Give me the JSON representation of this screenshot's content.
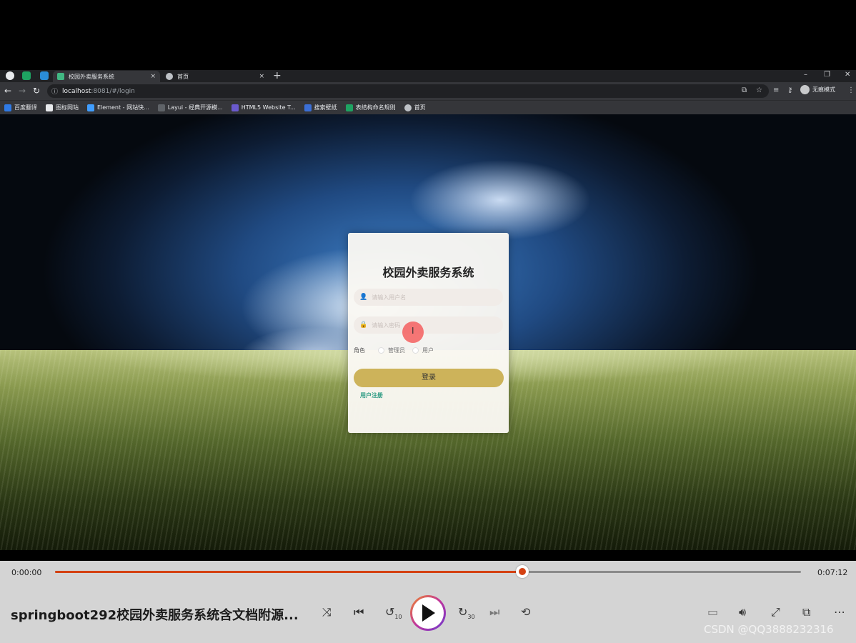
{
  "browser": {
    "tabs": [
      {
        "title": "校园外卖服务系统",
        "close": "×"
      },
      {
        "title": "首页",
        "close": "×"
      }
    ],
    "new_tab": "+",
    "window_controls": {
      "minimize": "–",
      "restore": "❐",
      "close": "✕"
    },
    "url_host": "localhost",
    "url_path": ":8081/#/login",
    "profile_label": "无痕模式",
    "bookmarks": [
      "百度翻译",
      "图标网站",
      "Element - 网站快...",
      "Layui - 经典开源模...",
      "HTML5 Website T...",
      "搜索壁纸",
      "表结构命名规则",
      "首页"
    ]
  },
  "login": {
    "title": "校园外卖服务系统",
    "username_placeholder": "请输入用户名",
    "password_placeholder": "请输入密码",
    "role_label": "角色",
    "role_options": [
      "管理员",
      "用户"
    ],
    "login_button": "登录",
    "register_link": "用户注册"
  },
  "player": {
    "current_time": "0:00:00",
    "total_time": "0:07:12",
    "progress": 0.626,
    "title": "springboot292校园外卖服务系统含文档附源...",
    "accent_color": "#d44112",
    "skip_back_seconds": "10",
    "skip_forward_seconds": "30"
  },
  "watermark": "CSDN @QQ3888232316",
  "icons": {
    "shuffle": "shuffle-icon",
    "previous": "previous-icon",
    "play": "play-icon",
    "next": "next-icon",
    "repeat": "repeat-icon",
    "captions": "captions-icon",
    "volume": "volume-icon",
    "fullscreen": "fullscreen-icon",
    "miniplayer": "miniplayer-icon",
    "more": "more-icon"
  }
}
